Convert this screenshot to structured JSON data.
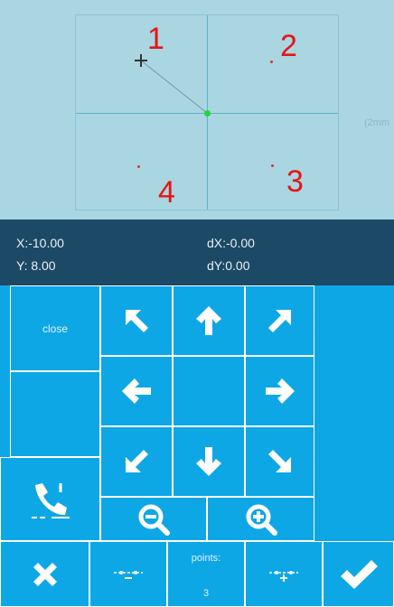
{
  "preview": {
    "scale_label": "(2mm",
    "point_labels": [
      "1",
      "2",
      "3",
      "4"
    ]
  },
  "readout": {
    "x": "X:-10.00",
    "y": "Y: 8.00",
    "dx": "dX:-0.00",
    "dy": "dY:0.00"
  },
  "panel": {
    "close_label": "close",
    "points_label": "points:",
    "points_value": "3"
  },
  "colors": {
    "panel_bg": "#0ea7e6",
    "readout_bg": "#1c4a66",
    "preview_bg": "#a9d6e1",
    "point_label": "#e51515",
    "origin": "#22d63c"
  },
  "icons": {
    "arrows": [
      "arrow-up-left-icon",
      "arrow-up-icon",
      "arrow-up-right-icon",
      "arrow-left-icon",
      "arrow-right-icon",
      "arrow-down-left-icon",
      "arrow-down-icon",
      "arrow-down-right-icon"
    ],
    "tools": [
      "path-tool-icon",
      "zoom-out-icon",
      "zoom-in-icon",
      "cancel-icon",
      "remove-point-icon",
      "add-point-icon",
      "confirm-icon"
    ]
  }
}
